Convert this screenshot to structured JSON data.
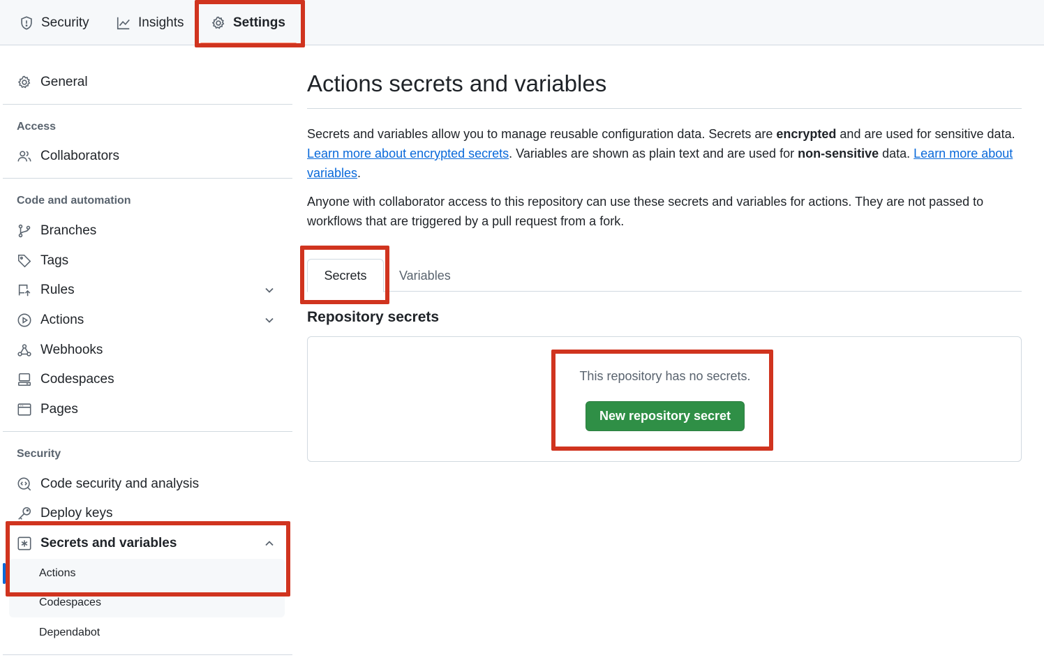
{
  "topnav": {
    "tabs": [
      {
        "label": "Security",
        "icon": "shield-icon"
      },
      {
        "label": "Insights",
        "icon": "graph-icon"
      },
      {
        "label": "Settings",
        "icon": "gear-icon",
        "selected": true
      }
    ]
  },
  "sidebar": {
    "general": "General",
    "access_heading": "Access",
    "collaborators": "Collaborators",
    "code_heading": "Code and automation",
    "branches": "Branches",
    "tags": "Tags",
    "rules": "Rules",
    "actions": "Actions",
    "webhooks": "Webhooks",
    "codespaces": "Codespaces",
    "pages": "Pages",
    "security_heading": "Security",
    "code_security": "Code security and analysis",
    "deploy_keys": "Deploy keys",
    "secrets_vars": "Secrets and variables",
    "sub_items": [
      "Actions",
      "Codespaces",
      "Dependabot"
    ]
  },
  "main": {
    "title": "Actions secrets and variables",
    "para1": {
      "t1": "Secrets and variables allow you to manage reusable configuration data. Secrets are ",
      "b1": "encrypted",
      "t2": " and are used for sensitive data. ",
      "link1": "Learn more about encrypted secrets",
      "t3": ". Variables are shown as plain text and are used for ",
      "b2": "non-sensitive",
      "t4": " data. ",
      "link2": "Learn more about variables",
      "t5": "."
    },
    "para2": "Anyone with collaborator access to this repository can use these secrets and variables for actions. They are not passed to workflows that are triggered by a pull request from a fork.",
    "tabs": [
      "Secrets",
      "Variables"
    ],
    "section_title": "Repository secrets",
    "empty_text": "This repository has no secrets.",
    "new_button": "New repository secret"
  },
  "colors": {
    "accent": "#0969da",
    "button_green": "#2f8f46",
    "annotation_red": "#d0341f",
    "tab_underline": "#fd8c73"
  }
}
